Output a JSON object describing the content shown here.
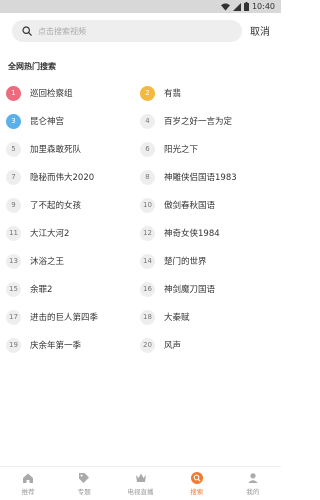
{
  "status": {
    "time": "10:40"
  },
  "search": {
    "placeholder": "点击搜索视频",
    "cancel_label": "取消"
  },
  "section_title": "全网热门搜索",
  "hot": [
    {
      "rank": "1",
      "label": "巡回检察组"
    },
    {
      "rank": "2",
      "label": "有翡"
    },
    {
      "rank": "3",
      "label": "昆仑神宫"
    },
    {
      "rank": "4",
      "label": "百岁之好一言为定"
    },
    {
      "rank": "5",
      "label": "加里森敢死队"
    },
    {
      "rank": "6",
      "label": "阳光之下"
    },
    {
      "rank": "7",
      "label": "隐秘而伟大2020"
    },
    {
      "rank": "8",
      "label": "神雕侠侣国语1983"
    },
    {
      "rank": "9",
      "label": "了不起的女孩"
    },
    {
      "rank": "10",
      "label": "傲剑春秋国语"
    },
    {
      "rank": "11",
      "label": "大江大河2"
    },
    {
      "rank": "12",
      "label": "神奇女侠1984"
    },
    {
      "rank": "13",
      "label": "沐浴之王"
    },
    {
      "rank": "14",
      "label": "楚门的世界"
    },
    {
      "rank": "15",
      "label": "余罪2"
    },
    {
      "rank": "16",
      "label": "神剑魔刀国语"
    },
    {
      "rank": "17",
      "label": "进击的巨人第四季"
    },
    {
      "rank": "18",
      "label": "大秦赋"
    },
    {
      "rank": "19",
      "label": "庆余年第一季"
    },
    {
      "rank": "20",
      "label": "风声"
    }
  ],
  "tabs": [
    {
      "label": "推荐",
      "icon": "home-icon",
      "active": false
    },
    {
      "label": "专题",
      "icon": "tag-icon",
      "active": false
    },
    {
      "label": "电视直播",
      "icon": "crown-icon",
      "active": false
    },
    {
      "label": "搜索",
      "icon": "search-icon",
      "active": true
    },
    {
      "label": "我的",
      "icon": "user-icon",
      "active": false
    }
  ],
  "colors": {
    "accent": "#f07b33",
    "rank1": "#f06a7e",
    "rank2": "#f5b83f",
    "rank3": "#5ab0e8"
  }
}
